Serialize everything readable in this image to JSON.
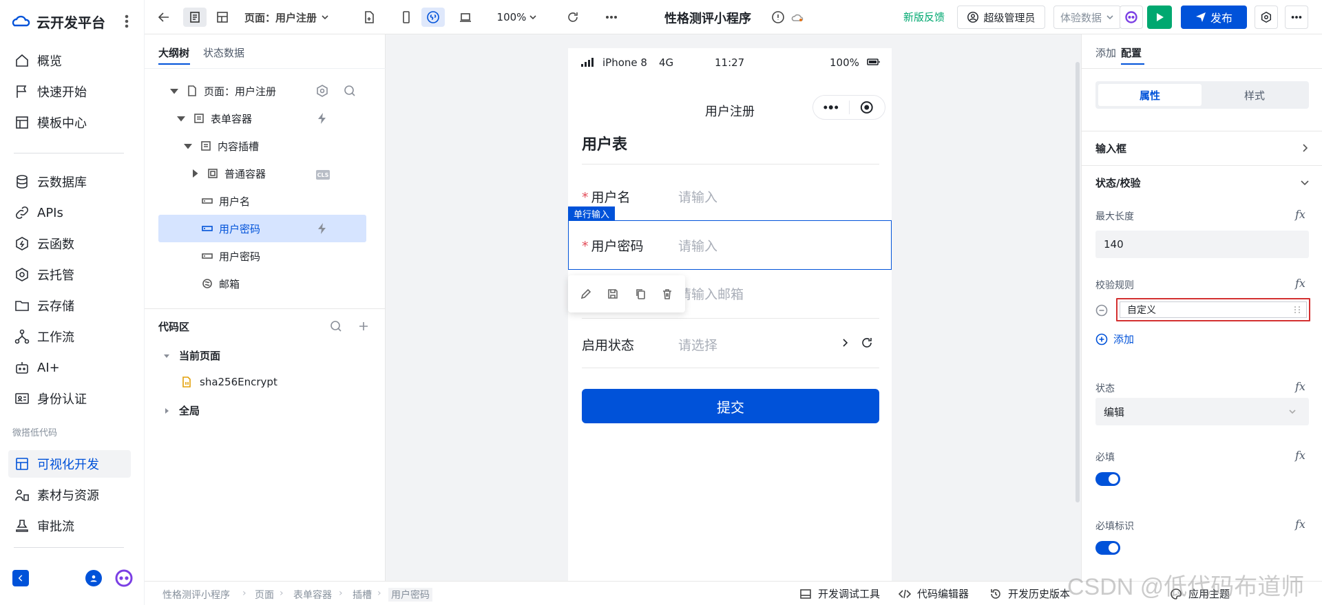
{
  "platform": {
    "name": "云开发平台"
  },
  "nav": {
    "items": [
      {
        "label": "概览"
      },
      {
        "label": "快速开始"
      },
      {
        "label": "模板中心"
      },
      {
        "label": "云数据库"
      },
      {
        "label": "APIs"
      },
      {
        "label": "云函数"
      },
      {
        "label": "云托管"
      },
      {
        "label": "云存储"
      },
      {
        "label": "工作流"
      },
      {
        "label": "AI+"
      },
      {
        "label": "身份认证"
      }
    ],
    "section": "微搭低代码",
    "lowcode_items": [
      {
        "label": "可视化开发",
        "active": true
      },
      {
        "label": "素材与资源"
      },
      {
        "label": "审批流"
      }
    ]
  },
  "toolbar": {
    "page_label": "页面：用户注册",
    "zoom": "100%",
    "app_title": "性格测评小程序",
    "feedback": "新版反馈",
    "admin": "超级管理员",
    "data_env": "体验数据",
    "publish": "发布"
  },
  "outline": {
    "tabs": [
      "大纲树",
      "状态数据"
    ],
    "tree": [
      {
        "label": "页面：用户注册"
      },
      {
        "label": "表单容器"
      },
      {
        "label": "内容插槽"
      },
      {
        "label": "普通容器",
        "badge": "CLS"
      },
      {
        "label": "用户名"
      },
      {
        "label": "用户密码",
        "selected": true
      },
      {
        "label": "用户密码"
      },
      {
        "label": "邮箱"
      }
    ],
    "code": {
      "title": "代码区",
      "current": "当前页面",
      "file": "sha256Encrypt",
      "global": "全局"
    }
  },
  "phone": {
    "device": "iPhone 8",
    "network": "4G",
    "time": "11:27",
    "battery": "100%",
    "title": "用户注册",
    "form_title": "用户表",
    "fields": [
      {
        "label": "用户名",
        "required": "*",
        "placeholder": "请输入"
      },
      {
        "label": "用户密码",
        "required": "*",
        "placeholder": "请输入"
      },
      {
        "label": "",
        "required": "",
        "placeholder": "请输入邮箱"
      },
      {
        "label": "启用状态",
        "required": "",
        "placeholder": "请选择"
      }
    ],
    "selected_tag": "单行输入",
    "submit": "提交"
  },
  "config": {
    "tabs": [
      "添加",
      "配置"
    ],
    "segments": [
      "属性",
      "样式"
    ],
    "sections": {
      "input": "输入框",
      "validation": "状态/校验"
    },
    "max_length_label": "最大长度",
    "max_length_value": "140",
    "rule_label": "校验规则",
    "rule_value": "自定义",
    "rule_add": "添加",
    "state_label": "状态",
    "state_value": "编辑",
    "required_label": "必填",
    "required_on": true,
    "required_mark_label": "必填标识",
    "required_mark_on": true,
    "fx": "fx"
  },
  "footer": {
    "breadcrumb": [
      "性格测评小程序",
      "页面",
      "表单容器",
      "插槽",
      "用户密码"
    ],
    "tools": [
      "开发调试工具",
      "代码编辑器",
      "开发历史版本",
      "应用主题"
    ]
  },
  "watermark": "CSDN @低代码布道师",
  "colors": {
    "accent": "#0052d9",
    "run": "#00a870",
    "highlight": "#d32f2f"
  }
}
